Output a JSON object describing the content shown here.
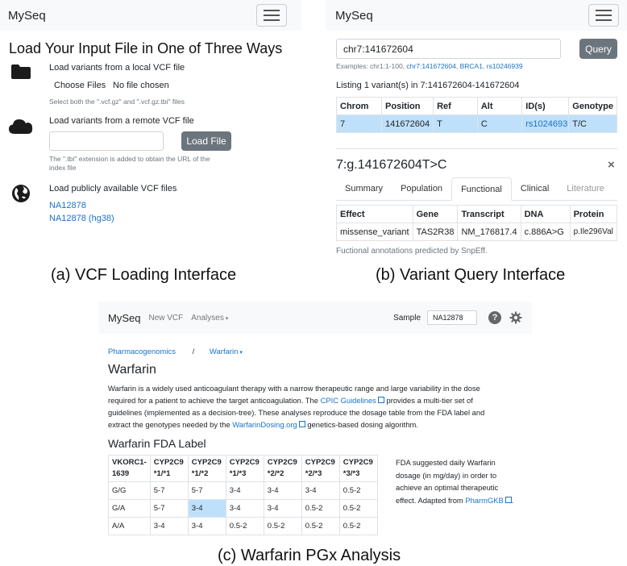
{
  "panel_a": {
    "brand": "MySeq",
    "title": "Load Your Input File in One of Three Ways",
    "local": {
      "label": "Load variants from a local VCF file",
      "choose_button": "Choose Files",
      "file_status": "No file chosen",
      "hint": "Select both the \".vcf.gz\" and \".vcf.gz.tbi\" files"
    },
    "remote": {
      "label": "Load variants from a remote VCF file",
      "url_value": "",
      "button": "Load File",
      "hint_line1": "The \".tbi\" extension is added to obtain the URL of the",
      "hint_line2": "index file"
    },
    "public": {
      "label": "Load publicly available VCF files",
      "links": [
        "NA12878",
        "NA12878 (hg38)"
      ]
    },
    "caption": "(a) VCF Loading Interface"
  },
  "panel_b": {
    "brand": "MySeq",
    "query_value": "chr7:141672604",
    "query_button": "Query",
    "examples_prefix": "Examples: chr1:1-100,",
    "example_links": [
      "chr7:141672604",
      "BRCA1",
      "rs10246939"
    ],
    "listing": "Listing 1 variant(s) in 7:141672604-141672604",
    "table_headers": [
      "Chrom",
      "Position",
      "Ref",
      "Alt",
      "ID(s)",
      "Genotype"
    ],
    "table_row": [
      "7",
      "141672604",
      "T",
      "C",
      "rs10246939",
      "T/C"
    ],
    "variant_title": "7:g.141672604T>C",
    "close_symbol": "×",
    "tabs": [
      "Summary",
      "Population",
      "Functional",
      "Clinical",
      "Literature"
    ],
    "func_headers": [
      "Effect",
      "Gene",
      "Transcript",
      "DNA",
      "Protein"
    ],
    "func_row": [
      "missense_variant",
      "TAS2R38",
      "NM_176817.4",
      "c.886A>G",
      "p.Ile296Val"
    ],
    "note": "Fuctional annotations predicted by SnpEff.",
    "caption": "(b) Variant Query Interface"
  },
  "panel_c": {
    "brand": "MySeq",
    "nav_new_vcf": "New VCF",
    "nav_analyses": "Analyses",
    "sample_label": "Sample",
    "sample_value": "NA12878",
    "breadcrumb_1": "Pharmacogenomics",
    "breadcrumb_sep": "/",
    "breadcrumb_2": "Warfarin",
    "title": "Warfarin",
    "para_1": "Warfarin is a widely used anticoagulant therapy with a narrow therapeutic range and large variability in the dose",
    "para_2a": "required for a patient to achieve the target anticoagulation. The",
    "para_2_link": "CPIC Guidelines",
    "para_2b": "provides a multi-tier set of",
    "para_3": "guidelines (implemented as a decision-tree). These analyses reproduce the dosage table from the FDA label and",
    "para_4a": "extract the genotypes needed by the",
    "para_4_link": "WarfarinDosing.org",
    "para_4b": "genetics-based dosing algorithm.",
    "fda_title": "Warfarin FDA Label",
    "headers": [
      {
        "l1": "VKORC1-",
        "l2": "1639"
      },
      {
        "l1": "CYP2C9",
        "l2": "*1/*1"
      },
      {
        "l1": "CYP2C9",
        "l2": "*1/*2"
      },
      {
        "l1": "CYP2C9",
        "l2": "*1/*3"
      },
      {
        "l1": "CYP2C9",
        "l2": "*2/*2"
      },
      {
        "l1": "CYP2C9",
        "l2": "*2/*3"
      },
      {
        "l1": "CYP2C9",
        "l2": "*3/*3"
      }
    ],
    "rows": [
      [
        "G/G",
        "5-7",
        "5-7",
        "3-4",
        "3-4",
        "3-4",
        "0.5-2"
      ],
      [
        "G/A",
        "5-7",
        "3-4",
        "3-4",
        "3-4",
        "0.5-2",
        "0.5-2"
      ],
      [
        "A/A",
        "3-4",
        "3-4",
        "0.5-2",
        "0.5-2",
        "0.5-2",
        "0.5-2"
      ]
    ],
    "side_1": "FDA suggested daily Warfarin",
    "side_2": "dosage (in mg/day) in order to",
    "side_3": "achieve an optimal therapeutic",
    "side_4a": "effect. Adapted from",
    "side_4_link": "PharmGKB",
    "side_4b": ".",
    "caption": "(c) Warfarin PGx Analysis"
  }
}
